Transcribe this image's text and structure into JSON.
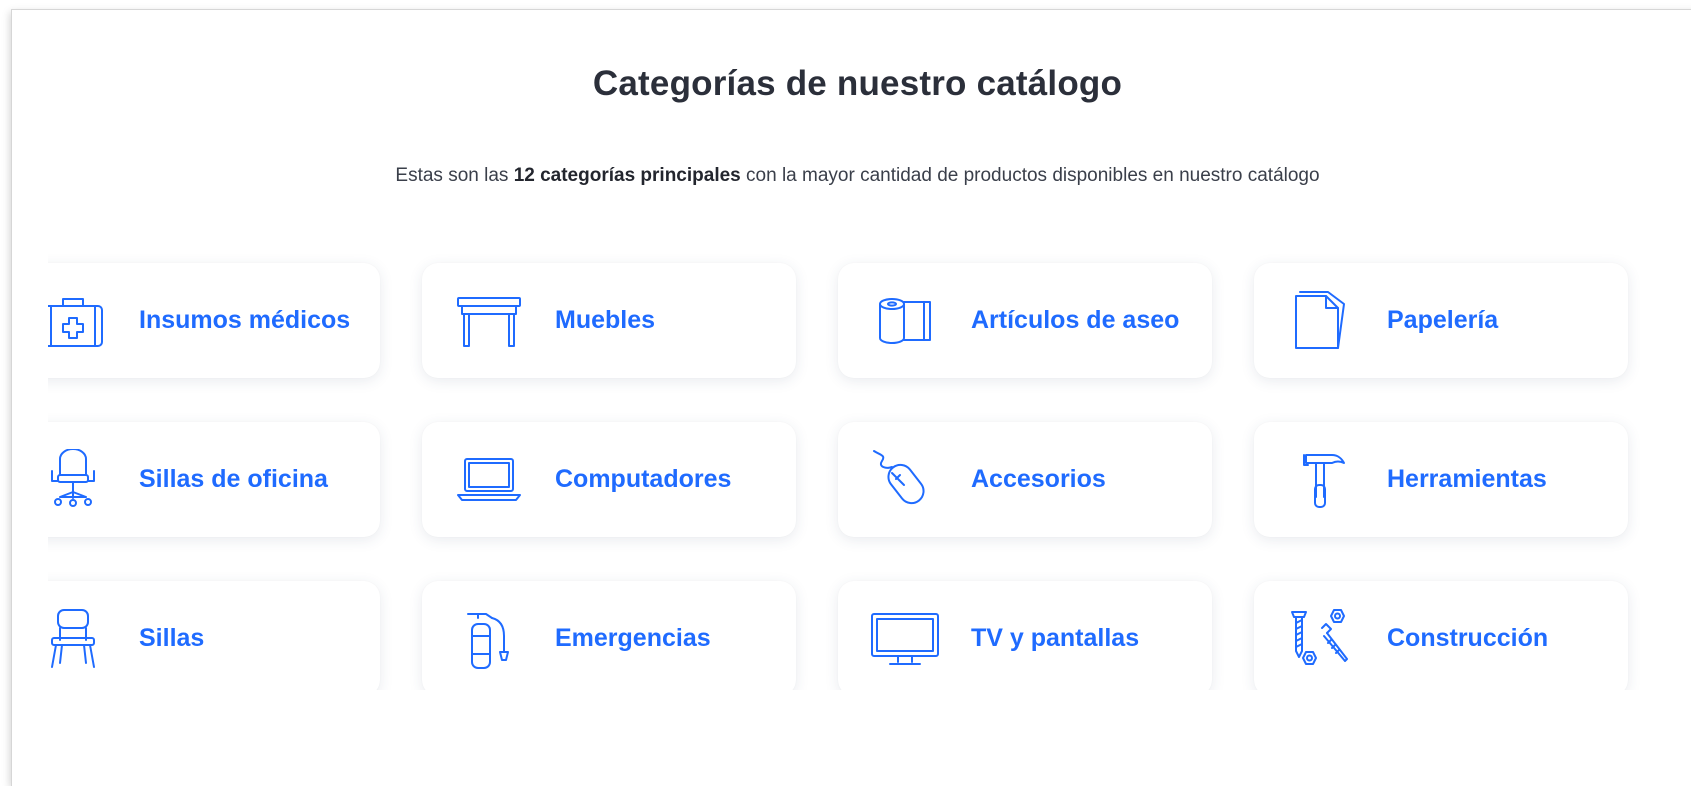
{
  "header": {
    "title": "Categorías de nuestro catálogo",
    "subtitle_before": "Estas son las ",
    "subtitle_bold": "12 categorías principales",
    "subtitle_after": " con la mayor cantidad de productos disponibles en nuestro catálogo"
  },
  "categories": [
    {
      "label": "Insumos médicos",
      "icon": "medical-kit-icon"
    },
    {
      "label": "Muebles",
      "icon": "table-icon"
    },
    {
      "label": "Artículos de aseo",
      "icon": "toilet-paper-icon"
    },
    {
      "label": "Papelería",
      "icon": "paper-sheets-icon"
    },
    {
      "label": "Sillas de oficina",
      "icon": "office-chair-icon"
    },
    {
      "label": "Computadores",
      "icon": "laptop-icon"
    },
    {
      "label": "Accesorios",
      "icon": "mouse-icon"
    },
    {
      "label": "Herramientas",
      "icon": "hammer-icon"
    },
    {
      "label": "Sillas",
      "icon": "chair-icon"
    },
    {
      "label": "Emergencias",
      "icon": "fire-extinguisher-icon"
    },
    {
      "label": "TV y pantallas",
      "icon": "tv-icon"
    },
    {
      "label": "Construcción",
      "icon": "screws-bolts-icon"
    }
  ],
  "colors": {
    "accent": "#1f6bff",
    "title": "#2b2f3a"
  }
}
